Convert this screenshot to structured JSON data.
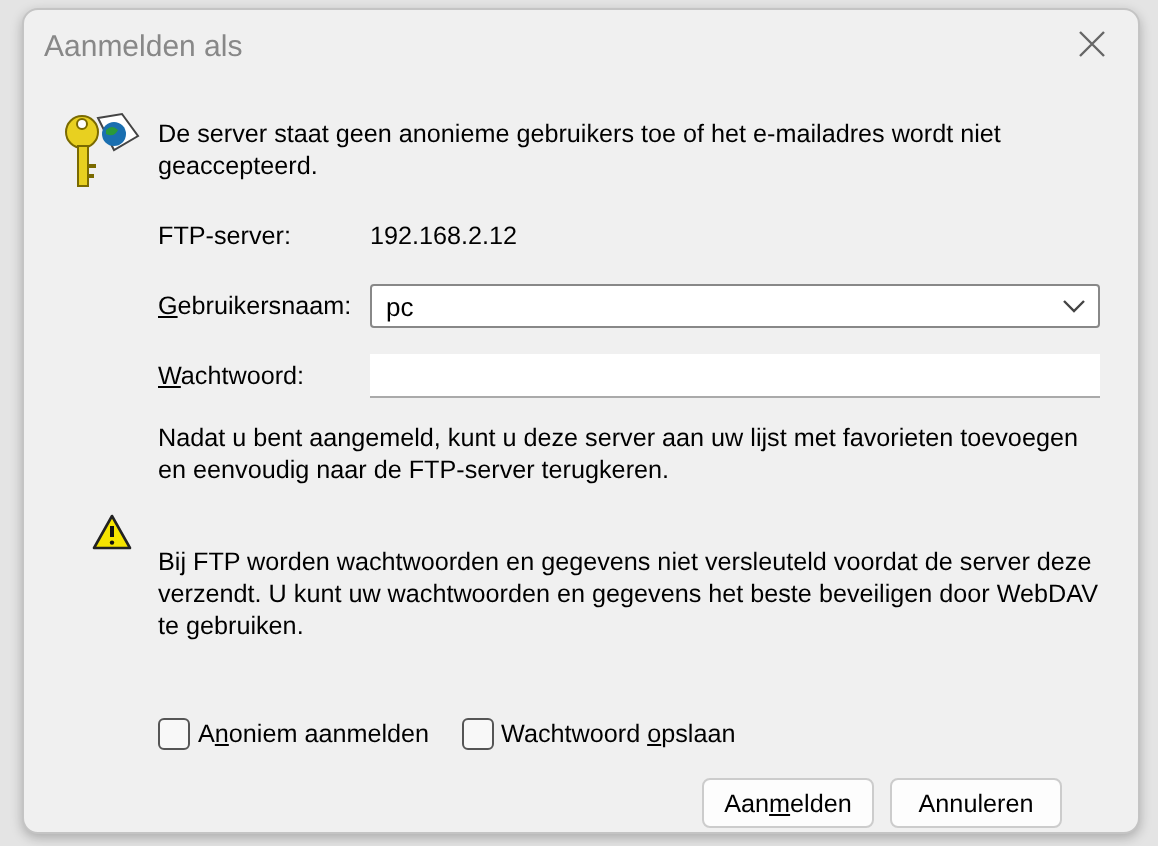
{
  "window": {
    "title": "Aanmelden als"
  },
  "message": "De server staat geen anonieme gebruikers toe of het e-mailadres wordt niet geaccepteerd.",
  "server": {
    "label": "FTP-server:",
    "value": "192.168.2.12"
  },
  "username": {
    "label": {
      "key": "G",
      "after": "ebruikersnaam:"
    },
    "value": "pc"
  },
  "password": {
    "label": {
      "key": "W",
      "after": "achtwoord:"
    }
  },
  "info": "Nadat u bent aangemeld, kunt u deze server aan uw lijst met favorieten toevoegen en eenvoudig naar de FTP-server terugkeren.",
  "warning": "Bij FTP worden wachtwoorden en gegevens niet versleuteld voordat de server deze verzendt. U kunt uw wachtwoorden en gegevens het beste beveiligen door WebDAV te gebruiken.",
  "checkboxes": [
    {
      "label": {
        "before": "A",
        "key": "n",
        "after": "oniem aanmelden"
      },
      "checked": false
    },
    {
      "label": {
        "before": "Wachtwoord ",
        "key": "o",
        "after": "pslaan"
      },
      "checked": false
    }
  ],
  "buttons": [
    {
      "label": {
        "before": "Aan",
        "key": "m",
        "after": "elden"
      }
    },
    {
      "label": {
        "after": "Annuleren"
      }
    }
  ]
}
